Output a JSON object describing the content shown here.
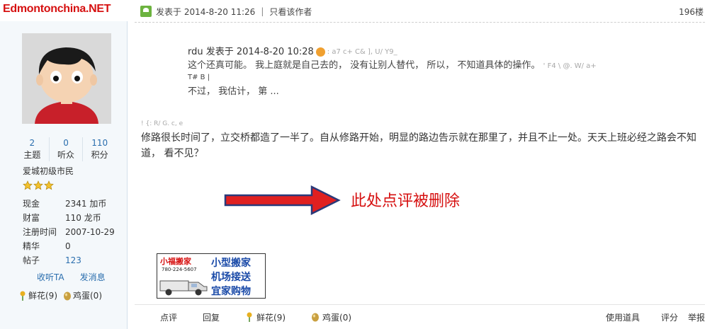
{
  "watermark": "Edmontonchina.NET",
  "user": {
    "stats": [
      {
        "value": "2",
        "label": "主题"
      },
      {
        "value": "0",
        "label": "听众"
      },
      {
        "value": "110",
        "label": "积分"
      }
    ],
    "rank": "爱城初级市民",
    "stars": 3,
    "info": [
      {
        "key": "现金",
        "value": "2341 加币"
      },
      {
        "key": "财富",
        "value": "110 龙币"
      },
      {
        "key": "注册时间",
        "value": "2007-10-29"
      },
      {
        "key": "精华",
        "value": "0"
      },
      {
        "key": "帖子",
        "value": "123"
      }
    ],
    "actions": {
      "follow": "收听TA",
      "message": "发消息"
    },
    "gifts": {
      "flower": "鲜花(9)",
      "egg": "鸡蛋(0)"
    }
  },
  "post": {
    "timestamp": "发表于 2014-8-20 11:26",
    "separator": "|",
    "author_only": "只看该作者",
    "floor": "196楼",
    "quote": {
      "author": "rdu",
      "date": "发表于 2014-8-20 10:28",
      "junk1": ": a7 c+ C& ], U/ Y9_",
      "line2": "这个还真可能。 我上庭就是自己去的， 没有让别人替代， 所以， 不知道具体的操作。",
      "junk2": "' F4 \\  @. W/ a+",
      "junk3": "T# B  |",
      "line3": "不过， 我估计， 第 ..."
    },
    "junk4": "! {: R/ G. c, e",
    "body": "修路很长时间了，立交桥都造了一半了。自从修路开始，明显的路边告示就在那里了，并且不止一处。天天上班必经之路会不知道， 看不见？",
    "annotation": "此处点评被删除"
  },
  "ad": {
    "name": "小福搬家",
    "phone": "780-224-5607",
    "line1": "小型搬家",
    "line2": "机场接送",
    "line3": "宜家购物"
  },
  "footer": {
    "rate": "点评",
    "reply": "回复",
    "flower": "鲜花(9)",
    "egg": "鸡蛋(0)",
    "use_tool": "使用道具",
    "score": "评分",
    "report": "举报"
  },
  "colors": {
    "brand_red": "#d61010",
    "link_blue": "#2a6eae",
    "sidebar_bg": "#f4f8fb"
  }
}
